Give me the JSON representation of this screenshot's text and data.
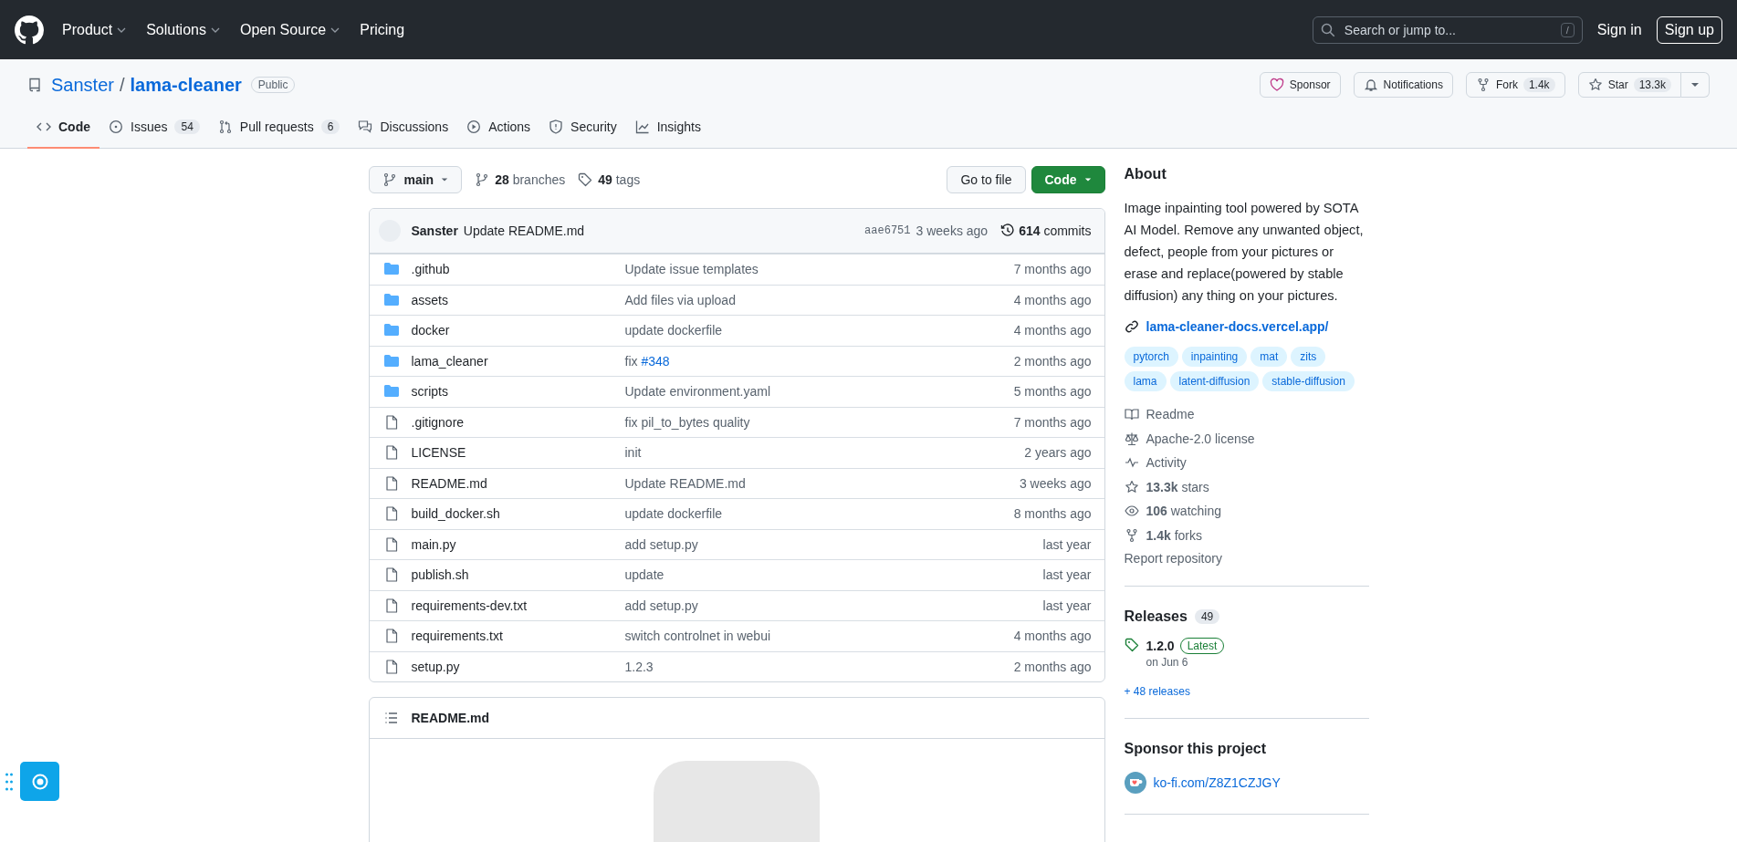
{
  "header": {
    "nav": [
      {
        "label": "Product",
        "dropdown": true
      },
      {
        "label": "Solutions",
        "dropdown": true
      },
      {
        "label": "Open Source",
        "dropdown": true
      },
      {
        "label": "Pricing",
        "dropdown": false
      }
    ],
    "search": {
      "placeholder": "Search or jump to...",
      "shortcut": "/"
    },
    "sign_in": "Sign in",
    "sign_up": "Sign up"
  },
  "repo": {
    "owner": "Sanster",
    "separator": "/",
    "name": "lama-cleaner",
    "visibility": "Public",
    "actions": [
      {
        "kind": "sponsor",
        "label": "Sponsor"
      },
      {
        "kind": "notifications",
        "label": "Notifications"
      },
      {
        "kind": "fork",
        "label": "Fork",
        "count": "1.4k"
      },
      {
        "kind": "star",
        "label": "Star",
        "count": "13.3k"
      }
    ]
  },
  "tabs": [
    {
      "kind": "code",
      "label": "Code",
      "selected": true
    },
    {
      "kind": "issues",
      "label": "Issues",
      "count": "54",
      "selected": false
    },
    {
      "kind": "pulls",
      "label": "Pull requests",
      "count": "6",
      "selected": false
    },
    {
      "kind": "discussions",
      "label": "Discussions",
      "selected": false
    },
    {
      "kind": "actions",
      "label": "Actions",
      "selected": false
    },
    {
      "kind": "security",
      "label": "Security",
      "selected": false
    },
    {
      "kind": "insights",
      "label": "Insights",
      "selected": false
    }
  ],
  "toolbar": {
    "branch": "main",
    "branches": "**28** branches",
    "tags": "**49** tags",
    "go_to_file": "Go to file",
    "code": "Code"
  },
  "latest_commit": {
    "author": "Sanster",
    "message": "Update README.md",
    "sha": "aae6751",
    "time": "3 weeks ago",
    "commits": "**614** commits"
  },
  "files": [
    {
      "kind": "dir",
      "name": ".github",
      "message": "Update issue templates",
      "time": "7 months ago"
    },
    {
      "kind": "dir",
      "name": "assets",
      "message": "Add files via upload",
      "time": "4 months ago"
    },
    {
      "kind": "dir",
      "name": "docker",
      "message": "update dockerfile",
      "time": "4 months ago"
    },
    {
      "kind": "dir",
      "name": "lama_cleaner",
      "message": "fix",
      "link": "#348",
      "time": "2 months ago"
    },
    {
      "kind": "dir",
      "name": "scripts",
      "message": "Update environment.yaml",
      "time": "5 months ago"
    },
    {
      "kind": "file",
      "name": ".gitignore",
      "message": "fix pil_to_bytes quality",
      "time": "7 months ago"
    },
    {
      "kind": "file",
      "name": "LICENSE",
      "message": "init",
      "time": "2 years ago"
    },
    {
      "kind": "file",
      "name": "README.md",
      "message": "Update README.md",
      "time": "3 weeks ago"
    },
    {
      "kind": "file",
      "name": "build_docker.sh",
      "message": "update dockerfile",
      "time": "8 months ago"
    },
    {
      "kind": "file",
      "name": "main.py",
      "message": "add setup.py",
      "time": "last year"
    },
    {
      "kind": "file",
      "name": "publish.sh",
      "message": "update",
      "time": "last year"
    },
    {
      "kind": "file",
      "name": "requirements-dev.txt",
      "message": "add setup.py",
      "time": "last year"
    },
    {
      "kind": "file",
      "name": "requirements.txt",
      "message": "switch controlnet in webui",
      "time": "4 months ago"
    },
    {
      "kind": "file",
      "name": "setup.py",
      "message": "1.2.3",
      "time": "2 months ago"
    }
  ],
  "readme": {
    "title": "README.md"
  },
  "about": {
    "title": "About",
    "description": "Image inpainting tool powered by SOTA AI Model. Remove any unwanted object, defect, people from your pictures or erase and replace(powered by stable diffusion) any thing on your pictures.",
    "website": "lama-cleaner-docs.vercel.app/",
    "topics": [
      "pytorch",
      "inpainting",
      "mat",
      "zits",
      "lama",
      "latent-diffusion",
      "stable-diffusion"
    ],
    "stats": [
      {
        "kind": "readme",
        "text": "Readme"
      },
      {
        "kind": "license",
        "text": "Apache-2.0 license"
      },
      {
        "kind": "activity",
        "text": "Activity"
      },
      {
        "kind": "stars",
        "text": "**13.3k** stars"
      },
      {
        "kind": "watching",
        "text": "**106** watching"
      },
      {
        "kind": "forks",
        "text": "**1.4k** forks"
      }
    ],
    "report": "Report repository"
  },
  "releases": {
    "title": "Releases",
    "count": "49",
    "latest_version": "1.2.0",
    "latest_badge": "Latest",
    "date": "on Jun 6",
    "more": "+ 48 releases"
  },
  "sponsor": {
    "title": "Sponsor this project",
    "link": "ko-fi.com/Z8Z1CZJGY"
  }
}
